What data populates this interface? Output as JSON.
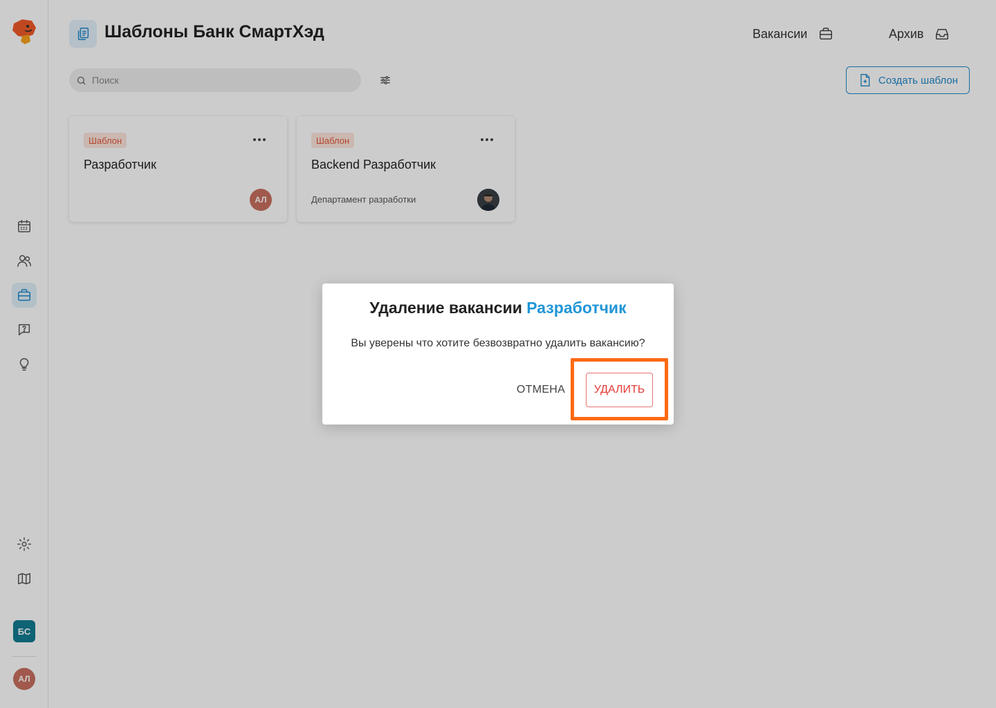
{
  "header": {
    "title": "Шаблоны Банк СмартХэд",
    "links": [
      {
        "label": "Вакансии",
        "icon": "briefcase-icon"
      },
      {
        "label": "Архив",
        "icon": "inbox-icon"
      }
    ]
  },
  "toolbar": {
    "search_placeholder": "Поиск",
    "create_label": "Создать шаблон"
  },
  "sidebar": {
    "items": [
      {
        "name": "calendar",
        "icon": "calendar-icon"
      },
      {
        "name": "candidates",
        "icon": "users-icon"
      },
      {
        "name": "vacancies",
        "icon": "briefcase-icon",
        "active": true
      },
      {
        "name": "interviews",
        "icon": "chat-question-icon"
      },
      {
        "name": "ideas",
        "icon": "lightbulb-icon"
      },
      {
        "name": "settings",
        "icon": "gear-icon"
      },
      {
        "name": "guide",
        "icon": "map-icon"
      }
    ],
    "workspace_badge": "БС",
    "user_initials": "АЛ"
  },
  "cards": [
    {
      "tag": "Шаблон",
      "title": "Разработчик",
      "department": "",
      "avatar_initials": "АЛ"
    },
    {
      "tag": "Шаблон",
      "title": "Backend Разработчик",
      "department": "Департамент разработки",
      "avatar_initials": ""
    }
  ],
  "modal": {
    "title_prefix": "Удаление вакансии",
    "title_accent": "Разработчик",
    "message": "Вы уверены что хотите безвозвратно удалить вакансию?",
    "cancel_label": "ОТМЕНА",
    "delete_label": "УДАЛИТЬ"
  },
  "colors": {
    "accent": "#1e88c8",
    "danger": "#e53935",
    "tag_text": "#e0573a",
    "highlight": "#ff6a13"
  }
}
